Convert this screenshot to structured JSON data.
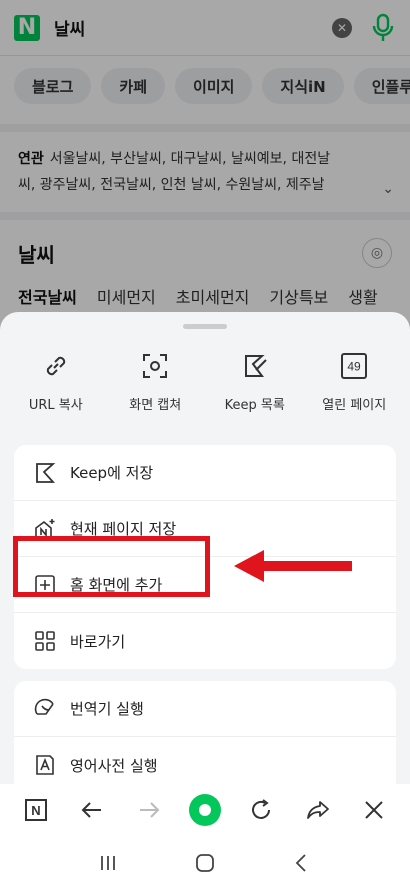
{
  "search": {
    "logo": "N",
    "query": "날씨",
    "clear": "✕"
  },
  "tabs": [
    "블로그",
    "카페",
    "이미지",
    "지식iN",
    "인플루언"
  ],
  "related": {
    "label": "연관",
    "line1": "서울날씨, 부산날씨, 대구날씨, 날씨예보, 대전날",
    "line2": "씨, 광주날씨, 전국날씨, 인천 날씨, 수원날씨, 제주날"
  },
  "weather": {
    "title": "날씨",
    "tabs": [
      "전국날씨",
      "미세먼지",
      "초미세먼지",
      "기상특보",
      "생활"
    ]
  },
  "sheet": {
    "quick": [
      {
        "label": "URL 복사",
        "icon": "link-icon"
      },
      {
        "label": "화면 캡쳐",
        "icon": "capture-icon"
      },
      {
        "label": "Keep 목록",
        "icon": "keep-list-icon"
      },
      {
        "label": "열린 페이지",
        "icon": "tabs-icon",
        "count": "49"
      }
    ],
    "menu1": [
      {
        "label": "Keep에 저장",
        "icon": "bookmark-icon"
      },
      {
        "label": "현재 페이지 저장",
        "icon": "save-page-icon"
      },
      {
        "label": "홈 화면에 추가",
        "icon": "add-home-icon"
      },
      {
        "label": "바로가기",
        "icon": "grid-icon"
      }
    ],
    "menu2": [
      {
        "label": "번역기 실행",
        "icon": "translate-icon"
      },
      {
        "label": "영어사전 실행",
        "icon": "dictionary-icon"
      }
    ]
  },
  "toolbar": {
    "home_logo": "N"
  },
  "colors": {
    "naver_green": "#03c75a",
    "highlight_red": "#e0141c"
  }
}
